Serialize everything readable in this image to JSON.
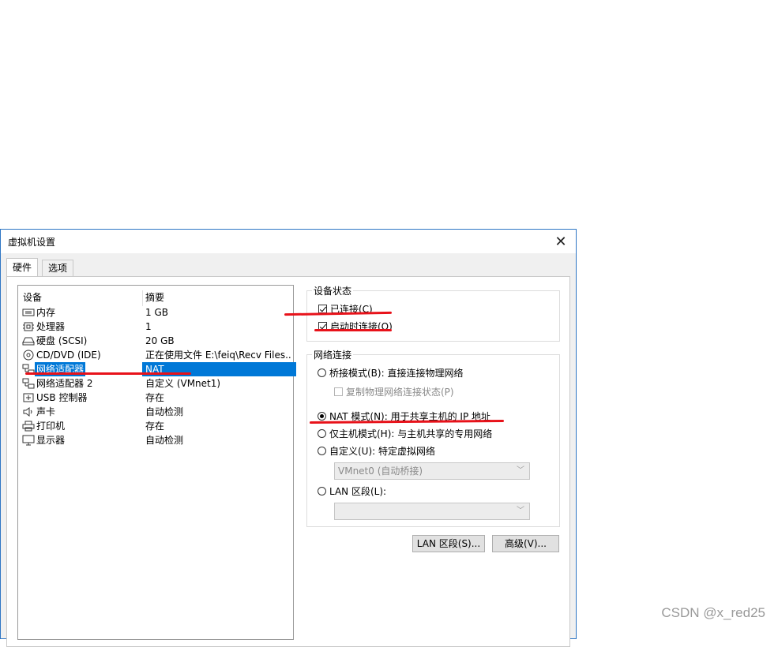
{
  "window": {
    "title": "虚拟机设置"
  },
  "tabs": [
    {
      "label": "硬件"
    },
    {
      "label": "选项"
    }
  ],
  "device_list": {
    "headers": {
      "device": "设备",
      "summary": "摘要"
    },
    "rows": [
      {
        "icon": "memory-icon",
        "name": "内存",
        "summary": "1 GB"
      },
      {
        "icon": "cpu-icon",
        "name": "处理器",
        "summary": "1"
      },
      {
        "icon": "hard-disk-icon",
        "name": "硬盘 (SCSI)",
        "summary": "20 GB"
      },
      {
        "icon": "cd-dvd-icon",
        "name": "CD/DVD (IDE)",
        "summary": "正在使用文件 E:\\feiq\\Recv Files..."
      },
      {
        "icon": "network-adapter-icon",
        "name": "网络适配器",
        "summary": "NAT",
        "selected": true
      },
      {
        "icon": "network-adapter-icon",
        "name": "网络适配器 2",
        "summary": "自定义 (VMnet1)"
      },
      {
        "icon": "usb-icon",
        "name": "USB 控制器",
        "summary": "存在"
      },
      {
        "icon": "sound-card-icon",
        "name": "声卡",
        "summary": "自动检测"
      },
      {
        "icon": "printer-icon",
        "name": "打印机",
        "summary": "存在"
      },
      {
        "icon": "display-icon",
        "name": "显示器",
        "summary": "自动检测"
      }
    ]
  },
  "device_status": {
    "title": "设备状态",
    "connected": {
      "label": "已连接(C)",
      "checked": true
    },
    "connect_at_power_on": {
      "label": "启动时连接(O)",
      "checked": true
    }
  },
  "network_connection": {
    "title": "网络连接",
    "bridged": {
      "label": "桥接模式(B): 直接连接物理网络",
      "selected": false
    },
    "replicate": {
      "label": "复制物理网络连接状态(P)",
      "checked": false
    },
    "nat": {
      "label": "NAT 模式(N): 用于共享主机的 IP 地址",
      "selected": true
    },
    "host_only": {
      "label": "仅主机模式(H): 与主机共享的专用网络",
      "selected": false
    },
    "custom": {
      "label": "自定义(U): 特定虚拟网络",
      "selected": false
    },
    "custom_select": {
      "value": "VMnet0 (自动桥接)"
    },
    "lan_segment": {
      "label": "LAN 区段(L):",
      "selected": false
    },
    "lan_select": {
      "value": ""
    }
  },
  "buttons": {
    "lan_segments": "LAN 区段(S)...",
    "advanced": "高级(V)..."
  },
  "annotation_color": "#e8121a",
  "watermark": "CSDN @x_red25"
}
